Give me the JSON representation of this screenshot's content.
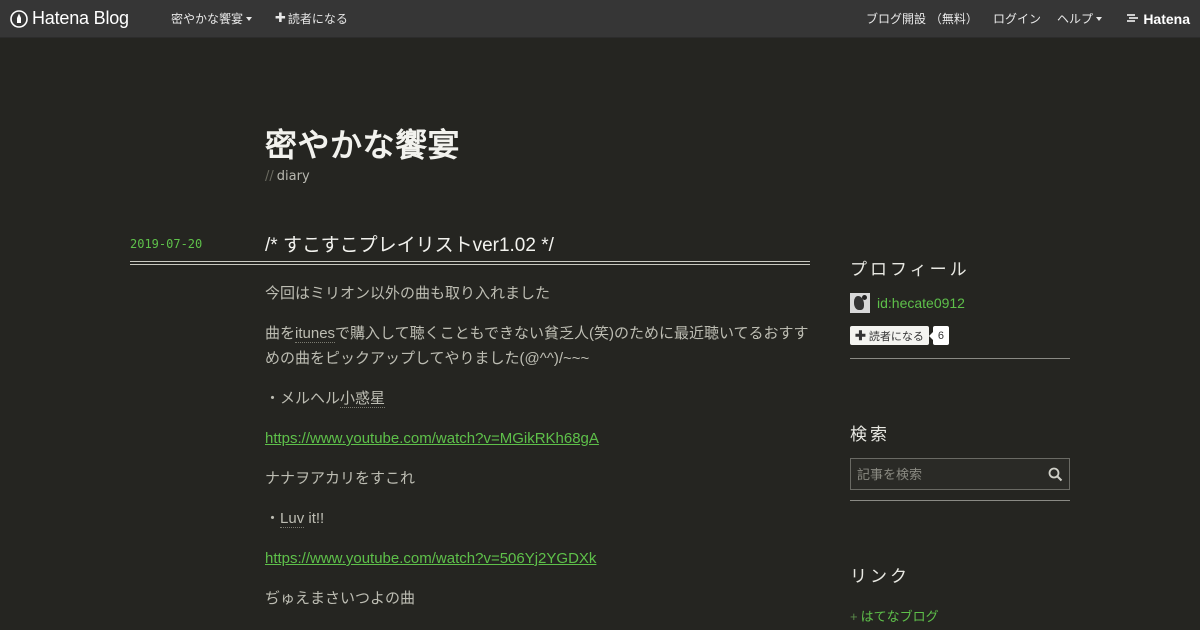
{
  "topbar": {
    "logo_text": "Hatena Blog",
    "blog_menu_label": "密やかな饗宴",
    "subscribe_label": "読者になる",
    "open_blog_label": "ブログ開設 （無料）",
    "login_label": "ログイン",
    "help_label": "ヘルプ",
    "hatena_logo_text": "Hatena"
  },
  "header": {
    "title": "密やかな饗宴",
    "description_prefix": "//",
    "description": "diary"
  },
  "entry": {
    "date": "2019-07-20",
    "title": "/*  すこすこプレイリストver1.02   */",
    "paragraphs": {
      "p1": "今回はミリオン以外の曲も取り入れました",
      "p2a": "曲を",
      "p2_kw": "itunes",
      "p2b": "で購入して聴くこともできない貧乏人(笑)のために最近聴いてるおすすめの曲をピックアップしてやりました(@^^)/~~~",
      "song1_prefix": "・メルヘル",
      "song1_kw": "小惑星",
      "link1": "https://www.youtube.com/watch?v=MGikRKh68gA",
      "comment1": "ナナヲアカリをすこれ",
      "song2_prefix": "・",
      "song2_kw": "Luv",
      "song2_suffix": " it!!",
      "link2": "https://www.youtube.com/watch?v=506Yj2YGDXk",
      "comment2": "ぢゅえまさいつよの曲"
    }
  },
  "sidebar": {
    "profile_title": "プロフィール",
    "profile_id": "id:hecate0912",
    "subscribe_label": "読者になる",
    "subscriber_count": "6",
    "search_title": "検索",
    "search_placeholder": "記事を検索",
    "links_title": "リンク",
    "link_prefix": "+",
    "link_1": "はてなブログ"
  }
}
